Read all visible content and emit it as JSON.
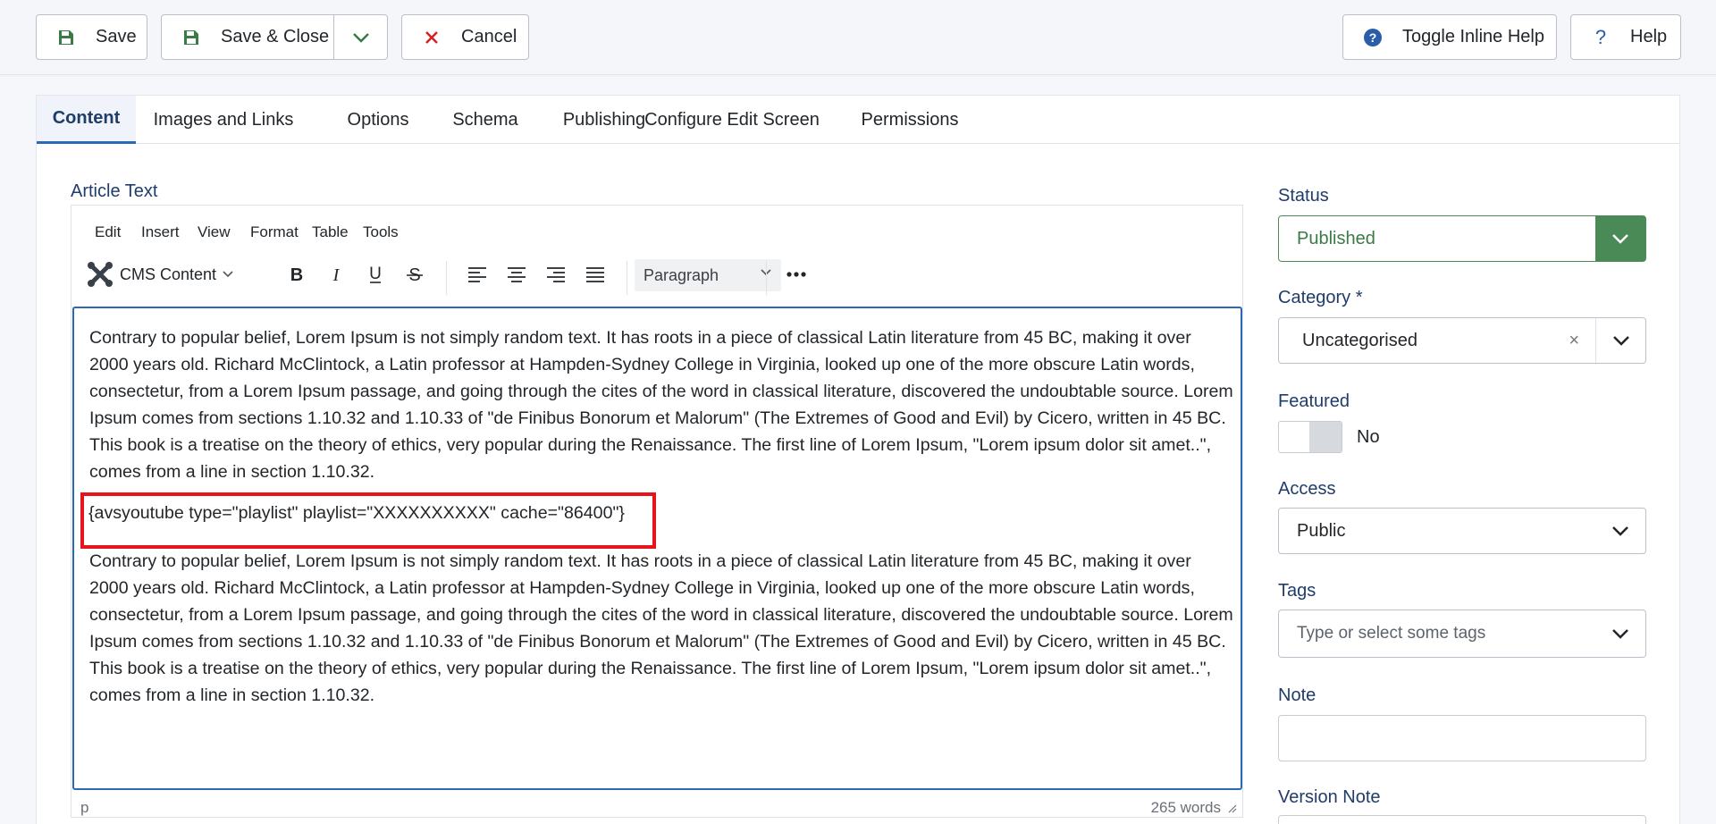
{
  "toolbar": {
    "save_label": "Save",
    "save_close_label": "Save & Close",
    "cancel_label": "Cancel",
    "inline_help_label": "Toggle Inline Help",
    "help_label": "Help"
  },
  "tabs": [
    {
      "label": "Content",
      "active": true
    },
    {
      "label": "Images and Links"
    },
    {
      "label": "Options"
    },
    {
      "label": "Schema"
    },
    {
      "label": "Publishing"
    },
    {
      "label": "Configure Edit Screen"
    },
    {
      "label": "Permissions"
    }
  ],
  "editor": {
    "label": "Article Text",
    "menu": [
      "Edit",
      "Insert",
      "View",
      "Format",
      "Table",
      "Tools"
    ],
    "cms_content_label": "CMS Content",
    "block_format": "Paragraph",
    "paragraph1": "Contrary to popular belief, Lorem Ipsum is not simply random text. It has roots in a piece of classical Latin literature from 45 BC, making it over 2000 years old. Richard McClintock, a Latin professor at Hampden-Sydney College in Virginia, looked up one of the more obscure Latin words, consectetur, from a Lorem Ipsum passage, and going through the cites of the word in classical literature, discovered the undoubtable source. Lorem Ipsum comes from sections 1.10.32 and 1.10.33 of \"de Finibus Bonorum et Malorum\" (The Extremes of Good and Evil) by Cicero, written in 45 BC. This book is a treatise on the theory of ethics, very popular during the Renaissance. The first line of Lorem Ipsum, \"Lorem ipsum dolor sit amet..\", comes from a line in section 1.10.32.",
    "shortcode": "{avsyoutube type=\"playlist\" playlist=\"XXXXXXXXXX\" cache=\"86400\"}",
    "paragraph2": "Contrary to popular belief, Lorem Ipsum is not simply random text. It has roots in a piece of classical Latin literature from 45 BC, making it over 2000 years old. Richard McClintock, a Latin professor at Hampden-Sydney College in Virginia, looked up one of the more obscure Latin words, consectetur, from a Lorem Ipsum passage, and going through the cites of the word in classical literature, discovered the undoubtable source. Lorem Ipsum comes from sections 1.10.32 and 1.10.33 of \"de Finibus Bonorum et Malorum\" (The Extremes of Good and Evil) by Cicero, written in 45 BC. This book is a treatise on the theory of ethics, very popular during the Renaissance. The first line of Lorem Ipsum, \"Lorem ipsum dolor sit amet..\", comes from a line in section 1.10.32.",
    "status_path": "p",
    "word_count": "265 words"
  },
  "sidebar": {
    "status_label": "Status",
    "status_value": "Published",
    "category_label": "Category *",
    "category_value": "Uncategorised",
    "featured_label": "Featured",
    "featured_value": "No",
    "access_label": "Access",
    "access_value": "Public",
    "tags_label": "Tags",
    "tags_placeholder": "Type or select some tags",
    "note_label": "Note",
    "note_value": "",
    "version_note_label": "Version Note"
  },
  "colors": {
    "accent": "#2a69b8",
    "published_green": "#4a8a56",
    "highlight_red": "#e8141c"
  },
  "icons": {
    "save": "floppy-disk-icon",
    "cancel": "x-icon",
    "inline_help": "question-circle-icon",
    "help": "question-icon",
    "cms": "joomla-logo-icon"
  }
}
